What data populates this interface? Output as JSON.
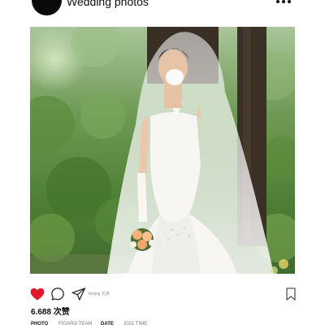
{
  "header": {
    "account_name": "Wedding photos",
    "avatar_icon": "avatar-circle",
    "more_icon": "more-horizontal-icon"
  },
  "post": {
    "photo_icon": "wedding-photo",
    "actions": {
      "like_icon": "heart-icon",
      "like_color": "#e0192b",
      "comment_icon": "comment-bubble-icon",
      "share_icon": "paper-plane-icon",
      "bookmark_icon": "bookmark-icon",
      "location": "beijing 北京"
    },
    "likes": "6.688 次赞",
    "meta": {
      "photo_label": "PHOTO",
      "photo_value": "FIGARO TEAM",
      "date_label": "DATE",
      "date_value": "2021 TIME"
    }
  }
}
